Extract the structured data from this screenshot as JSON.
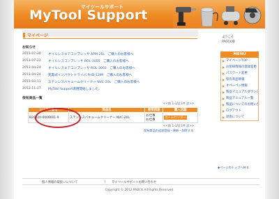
{
  "header": {
    "logo_sub": "マイツールサポート",
    "logo": "MyTool Support"
  },
  "page_title": "マイページ",
  "news_heading": "お知らせ",
  "news": [
    {
      "date": "2013-07-30",
      "message": "オイルレスエアコンプレッサ APM-25L　ご購入のお客様へ"
    },
    {
      "date": "2013-07-22",
      "message": "オイルレスコンプレッサ ROL-305S　ご購入のお客様へ"
    },
    {
      "date": "2013-04-24",
      "message": "オイルレスエアコンプレッサ ROL-3003　ご購入のお客様へ"
    },
    {
      "date": "2013-04-24",
      "message": "充電式インパクトドライバ PHD-12IM　ご購入のお客様へ"
    },
    {
      "date": "2013-03-11",
      "message": "ステンレスバキュームクリーナー NVC-20L　ご購入のお客様へ"
    },
    {
      "date": "2012-11-17",
      "message": "MyTool Support運用開始しました。"
    }
  ],
  "products_heading": "保有商品一覧",
  "count_top": {
    "prefix": "<<前  ",
    "page": "1-1/全1件",
    "next": "  次>>"
  },
  "table": {
    "headers": [
      "シリアル番号",
      "商品名",
      "使用用途",
      "購入店舗"
    ],
    "rows": [
      {
        "serial": "B20020-0000001-9",
        "name": "ステンレスバキュームクリーナー NVC-20L",
        "usage": [
          "お仕事",
          "お仕事"
        ],
        "store": "ホームセンター"
      }
    ]
  },
  "count_bottom": {
    "prefix": "<<前  ",
    "page": "1-1/全1件",
    "next": "  次>>"
  },
  "count_note": "保有商品の追加登録・更新・削除する",
  "back_to_top": "◆ページのトップへ戻る",
  "user": {
    "greeting": "ようこそ",
    "name": "PAOCK様"
  },
  "menu": {
    "title": "MENU",
    "items": [
      "マイページTOP",
      "お客様情報の登録変更",
      "パスワード変更",
      "保有商品情報",
      "オペーペン情報",
      "製品マニュアルダウンロード",
      "製品マニュアル一覧",
      "製品についてのお問い合わせ",
      "ログアウト",
      "退会について"
    ]
  },
  "footer": {
    "links": [
      "個人情報の取扱いについて",
      "マイツールサポートお問い合わせ"
    ],
    "copyright": "Copyright © 2012 PAOCK All Rights Reserved."
  }
}
